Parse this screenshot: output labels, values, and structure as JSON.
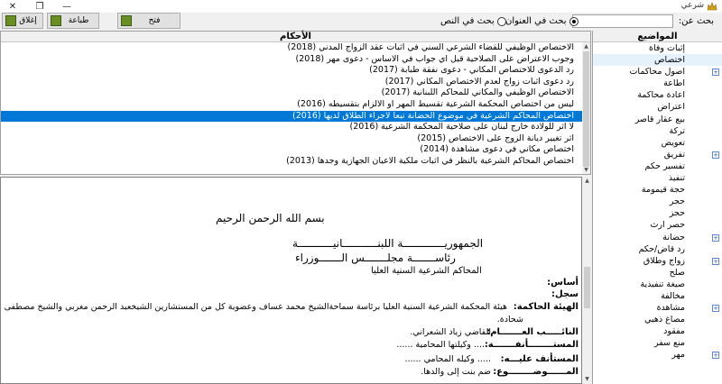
{
  "window": {
    "title": "شرعي",
    "close_glyph": "✕",
    "maximize_glyph": "❐",
    "minimize_glyph": "—"
  },
  "search": {
    "label": "بحث عن:",
    "value": "",
    "placeholder": "",
    "options": [
      {
        "label": "بحث في العنوان",
        "selected": true
      },
      {
        "label": "بحث في النص",
        "selected": false
      }
    ]
  },
  "toolbar": {
    "open_label": "فتح",
    "print_label": "طباعة",
    "close_label": "إغلاق"
  },
  "topics": {
    "header": "المواضيع",
    "items": [
      {
        "label": "إثبات وفاة",
        "expandable": false
      },
      {
        "label": "اختصاص",
        "expandable": false,
        "selected": true
      },
      {
        "label": "اصول محاكمات",
        "expandable": true
      },
      {
        "label": "اطاعة",
        "expandable": false
      },
      {
        "label": "اعادة محاكمة",
        "expandable": false
      },
      {
        "label": "اعتراض",
        "expandable": false
      },
      {
        "label": "بيع عقار قاصر",
        "expandable": false
      },
      {
        "label": "تركة",
        "expandable": false
      },
      {
        "label": "تعويض",
        "expandable": false
      },
      {
        "label": "تفريق",
        "expandable": true
      },
      {
        "label": "تفسير حكم",
        "expandable": false
      },
      {
        "label": "تنفيذ",
        "expandable": false
      },
      {
        "label": "حجة قيمومة",
        "expandable": false
      },
      {
        "label": "حجر",
        "expandable": false
      },
      {
        "label": "حجز",
        "expandable": false
      },
      {
        "label": "حصر ارث",
        "expandable": false
      },
      {
        "label": "حضانة",
        "expandable": true
      },
      {
        "label": "رد قاض/حكم",
        "expandable": false
      },
      {
        "label": "زواج وطلاق",
        "expandable": true
      },
      {
        "label": "صلح",
        "expandable": false
      },
      {
        "label": "صيغة تنفيذية",
        "expandable": false
      },
      {
        "label": "مخالفة",
        "expandable": false
      },
      {
        "label": "مشاهدة",
        "expandable": true
      },
      {
        "label": "مصاغ ذهبي",
        "expandable": false
      },
      {
        "label": "مفقود",
        "expandable": false
      },
      {
        "label": "منع سفر",
        "expandable": false
      },
      {
        "label": "مهر",
        "expandable": true
      }
    ]
  },
  "rulings": {
    "header": "الأحكام",
    "selected_index": 8,
    "items": [
      "الاختصاص الوظيفي للقضاء الشرعي السني في اثبات عقد الزواج المدني (2018)",
      "وجوب الاعتراض على الصلاحية قبل اي جواب في الاساس - دعوى مهر (2018)",
      "رد الدعوى للاختصاص المكاني - دعوى نفقة طبابة (2017)",
      "رد دعوى اثبات زواج لعدم الاختصاص المكاني (2017)",
      "الاختصاص الوظيفي والمكاني للمحاكم اللبنانية (2017)",
      "ليس من اختصاص المحكمة الشرعية تقسيط المهر او الالزام بتقسيطه (2016)",
      "اختصاص المحاكم الشرعية في موضوع الحضانة تبعا لاجراء الطلاق لديها (2016)",
      "لا اثر للولادة خارج لبنان على صلاحية المحكمة الشرعية (2016)",
      "اثر تغيير ديانة الزوج على الاختصاص (2015)",
      "اختصاص مكاني في دعوى مشاهدة (2014)",
      "اختصاص المحاكم الشرعية بالنظر في اثبات ملكية الاعيان الجهازية وجدها (2013)"
    ]
  },
  "document": {
    "basmala": "بسم الله الرحمن الرحيم",
    "republic": "الجمهوريـــــــــــــة اللبنـــــــــــانيـــــــــــة",
    "council": "رئاســـــــة مجلـــــــس الـــــــوزراء",
    "court": "المحاكم الشرعية السنية العليا",
    "basis_label": "أساس:",
    "record_label": "سجل:",
    "panel_label": "الهيئة الحاكمة:",
    "panel_text": "هيئة المحكمة الشرعية السنية العليا برئاسة سماحةالشيخ محمد عساف وعضوية كل من المستشارين الشيخعبد الرحمن مغربي والشيخ مصطفى",
    "panel_text_cont": "شحادة.",
    "deputy_label": "النائـــــب العـــــــام:",
    "deputy_text": "القاضي زياد الشعراني.",
    "appellant_label": "المستــــــــأنفـــــــة:",
    "appellant_text": "..... وكيلتها المحامية ......",
    "appellee_label": "المستأنف عليـــه:",
    "appellee_text": "..... وكيله المحامي ......",
    "subject_label": "المــــــوضــــــــوع:",
    "subject_text": "ضم بنت إلى والدها."
  }
}
